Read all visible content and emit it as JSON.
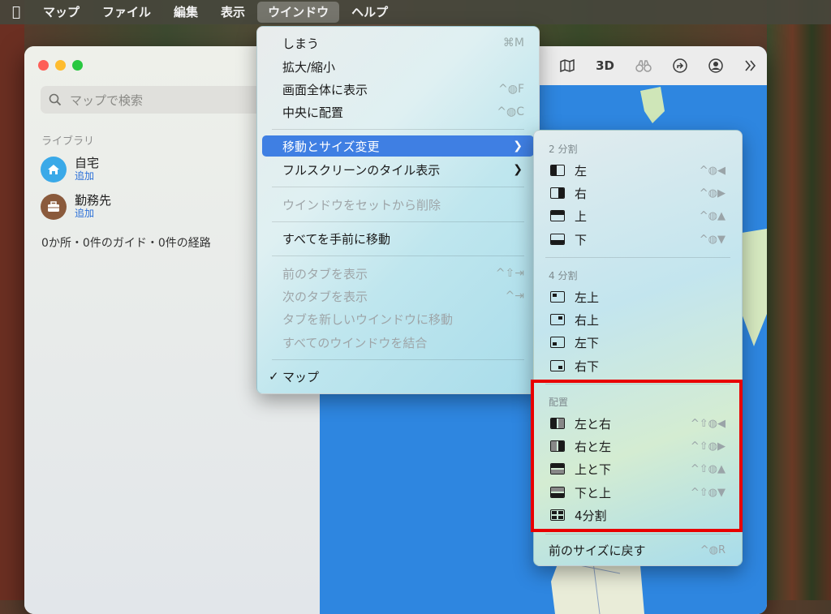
{
  "menubar": {
    "items": [
      {
        "label": "マップ"
      },
      {
        "label": "ファイル"
      },
      {
        "label": "編集"
      },
      {
        "label": "表示"
      },
      {
        "label": "ウインドウ"
      },
      {
        "label": "ヘルプ"
      }
    ],
    "active": "ウインドウ"
  },
  "sidebar": {
    "search_placeholder": "マップで検索",
    "library_title": "ライブラリ",
    "places": [
      {
        "name": "自宅",
        "action": "追加",
        "icon": "home-icon",
        "color": "#3aa9e8"
      },
      {
        "name": "勤務先",
        "action": "追加",
        "icon": "briefcase-icon",
        "color": "#8a5a3c"
      }
    ],
    "summary": "0か所・0件のガイド・0件の経路"
  },
  "map_toolbar": {
    "view_3d": "3D",
    "icons": [
      "map-icon",
      "3d-button",
      "binoculars-icon",
      "directions-icon",
      "account-icon",
      "more-icon"
    ]
  },
  "window_menu": {
    "items": [
      {
        "label": "しまう",
        "shortcut": "⌘M"
      },
      {
        "label": "拡大/縮小",
        "shortcut": ""
      },
      {
        "label": "画面全体に表示",
        "shortcut": "^◍F"
      },
      {
        "label": "中央に配置",
        "shortcut": "^◍C"
      },
      {
        "label": "移動とサイズ変更",
        "shortcut": "",
        "submenu": true,
        "highlighted": true
      },
      {
        "label": "フルスクリーンのタイル表示",
        "shortcut": "",
        "submenu": true
      },
      {
        "label": "ウインドウをセットから削除",
        "shortcut": "",
        "disabled": true
      },
      {
        "label": "すべてを手前に移動",
        "shortcut": ""
      },
      {
        "label": "前のタブを表示",
        "shortcut": "^⇧⇥",
        "disabled": true
      },
      {
        "label": "次のタブを表示",
        "shortcut": "^⇥",
        "disabled": true
      },
      {
        "label": "タブを新しいウインドウに移動",
        "shortcut": "",
        "disabled": true
      },
      {
        "label": "すべてのウインドウを結合",
        "shortcut": "",
        "disabled": true
      },
      {
        "label": "マップ",
        "shortcut": "",
        "checked": true
      }
    ]
  },
  "submenu": {
    "section_half": "2 分割",
    "half": [
      {
        "label": "左",
        "shortcut": "^◍◀"
      },
      {
        "label": "右",
        "shortcut": "^◍▶"
      },
      {
        "label": "上",
        "shortcut": "^◍▲"
      },
      {
        "label": "下",
        "shortcut": "^◍▼"
      }
    ],
    "section_quarter": "4 分割",
    "quarter": [
      {
        "label": "左上"
      },
      {
        "label": "右上"
      },
      {
        "label": "左下"
      },
      {
        "label": "右下"
      }
    ],
    "section_arrange": "配置",
    "arrange": [
      {
        "label": "左と右",
        "shortcut": "^⇧◍◀"
      },
      {
        "label": "右と左",
        "shortcut": "^⇧◍▶"
      },
      {
        "label": "上と下",
        "shortcut": "^⇧◍▲"
      },
      {
        "label": "下と上",
        "shortcut": "^⇧◍▼"
      },
      {
        "label": "4分割",
        "shortcut": ""
      }
    ],
    "return": {
      "label": "前のサイズに戻す",
      "shortcut": "^◍R"
    }
  },
  "highlight_color": "#e80000"
}
